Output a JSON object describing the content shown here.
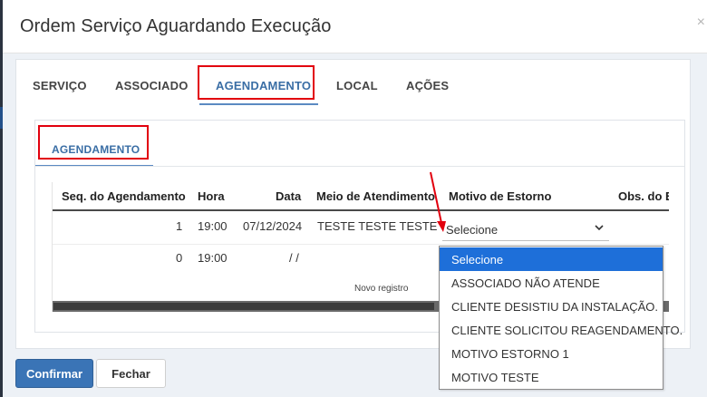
{
  "modal": {
    "title": "Ordem Serviço Aguardando Execução",
    "close_symbol": "×"
  },
  "main_tabs": [
    {
      "label": "SERVIÇO",
      "active": false
    },
    {
      "label": "ASSOCIADO",
      "active": false
    },
    {
      "label": "AGENDAMENTO",
      "active": true
    },
    {
      "label": "LOCAL",
      "active": false
    },
    {
      "label": "AÇÕES",
      "active": false
    }
  ],
  "inner_tab": {
    "label": "AGENDAMENTO"
  },
  "grid": {
    "columns": [
      "Seq. do Agendamento",
      "Hora",
      "Data",
      "Meio de Atendimento",
      "Motivo de Estorno",
      "Obs. do E"
    ],
    "rows": [
      {
        "seq": "1",
        "hora": "19:00",
        "data": "07/12/2024",
        "meio": "TESTE TESTE TESTE",
        "motivo": "Selecione"
      },
      {
        "seq": "0",
        "hora": "19:00",
        "data": "/ /",
        "meio": "",
        "motivo": ""
      }
    ],
    "new_record_label": "Novo registro"
  },
  "dropdown": {
    "selected": "Selecione",
    "options": [
      "Selecione",
      "ASSOCIADO NÃO ATENDE",
      "CLIENTE DESISTIU DA INSTALAÇÃO.",
      "CLIENTE SOLICITOU REAGENDAMENTO.",
      "MOTIVO ESTORNO 1",
      "MOTIVO TESTE"
    ]
  },
  "footer": {
    "confirm_label": "Confirmar",
    "close_label": "Fechar"
  },
  "colors": {
    "accent": "#3a74b6",
    "highlight": "#e2000e",
    "dropdown_selected": "#1e6fd9"
  }
}
